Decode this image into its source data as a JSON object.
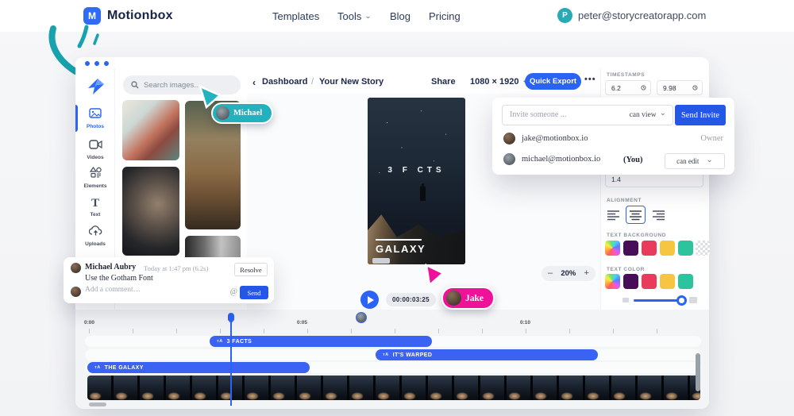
{
  "nav": {
    "logo_initial": "M",
    "logo": "Motionbox",
    "links": [
      {
        "label": "Templates"
      },
      {
        "label": "Tools"
      },
      {
        "label": "Blog"
      },
      {
        "label": "Pricing"
      }
    ],
    "user_initial": "P",
    "user_email": "peter@storycreatorapp.com"
  },
  "header": {
    "back": "‹",
    "breadcrumb_root": "Dashboard",
    "breadcrumb_sep": "/",
    "title": "Your New Story",
    "share": "Share",
    "canvas_size": "1080 × 1920",
    "quick_export": "Quick Export",
    "more": "•••"
  },
  "sidebar": {
    "items": [
      {
        "label": "Photos"
      },
      {
        "label": "Videos"
      },
      {
        "label": "Elements"
      },
      {
        "label": "Text"
      },
      {
        "label": "Uploads"
      }
    ],
    "text_icon_glyph": "T"
  },
  "search": {
    "placeholder": "Search images..."
  },
  "preview": {
    "title": "3 F CTS",
    "caption": "GALAXY"
  },
  "playback": {
    "time": "00:00:03:25",
    "zoom_minus": "–",
    "zoom_value": "20%",
    "zoom_plus": "+"
  },
  "timestamps": {
    "label": "TIMESTAMPS",
    "start": "6.2",
    "end": "9.98"
  },
  "properties": {
    "line_height": "1.4",
    "alignment_label": "ALIGNMENT",
    "text_background_label": "TEXT BACKGROUND",
    "text_color_label": "TEXT COLOR",
    "text_background_colors": [
      "rainbow",
      "#470d59",
      "#e73c5c",
      "#f6c643",
      "#2dc39c",
      "transparent"
    ],
    "text_color_colors": [
      "rainbow",
      "#470d59",
      "#e73c5c",
      "#f6c643",
      "#2dc39c"
    ]
  },
  "invite": {
    "placeholder": "Invite someone ...",
    "role_selector": "can view",
    "send": "Send Invite",
    "members": [
      {
        "email": "jake@motionbox.io",
        "role": "Owner"
      },
      {
        "email": "michael@motionbox.io",
        "you": "(You)",
        "role": "can edit"
      }
    ]
  },
  "comment": {
    "author": "Michael Aubry",
    "meta": "Today at 1:47 pm (6.2s)",
    "text": "Use the Gotham Font",
    "resolve": "Resolve",
    "placeholder": "Add a comment…",
    "mention": "@",
    "send": "Send"
  },
  "cursors": {
    "michael": "Michael",
    "jake": "Jake"
  },
  "timeline": {
    "ruler": [
      "0:00",
      "0:05",
      "0:10"
    ],
    "track_icon": "ᴛA",
    "tracks": [
      {
        "label": "3 FACTS"
      },
      {
        "label": "IT'S WARPED"
      },
      {
        "label": "THE GALAXY"
      }
    ]
  },
  "colors": {
    "accent_blue": "#2b63f6",
    "pink": "#f0119b",
    "teal": "#23b1bd",
    "send_blue": "#2457e6"
  }
}
